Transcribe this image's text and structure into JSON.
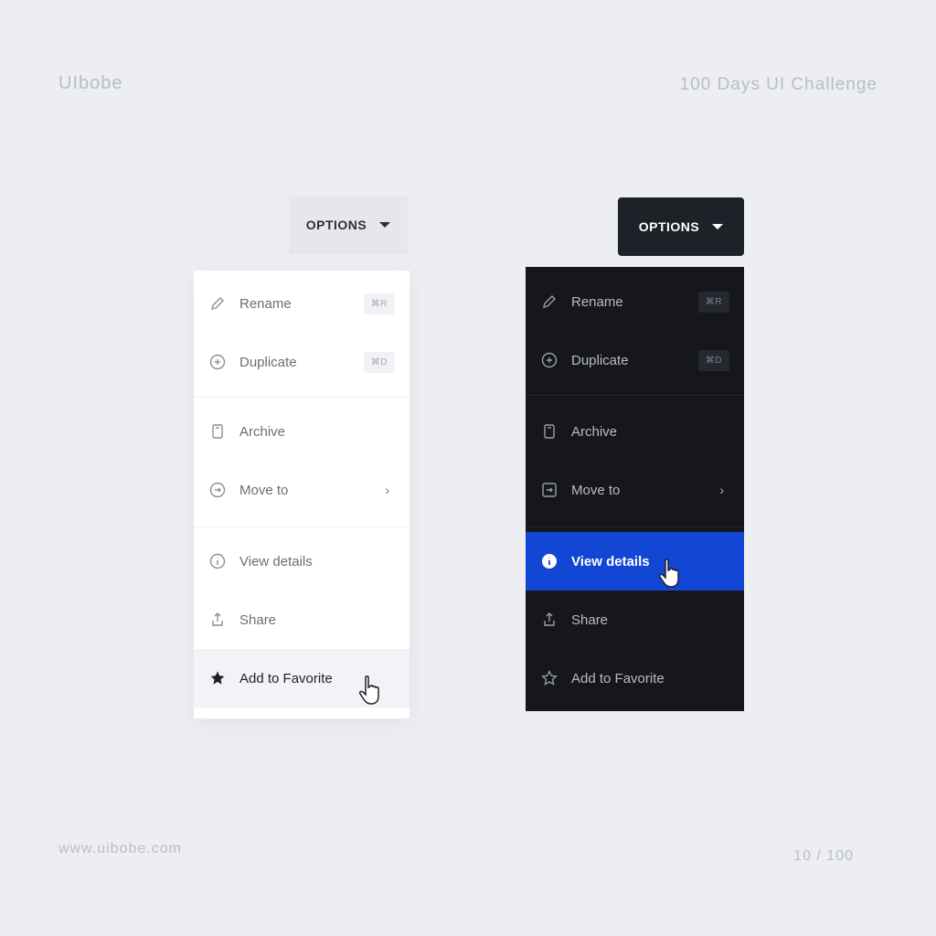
{
  "header": {
    "brand": "UIbobe",
    "series": "100 Days UI Challenge"
  },
  "footer": {
    "website": "www.uibobe.com",
    "page": "10 / 100"
  },
  "light": {
    "button_label": "OPTIONS",
    "items": [
      {
        "label": "Rename",
        "shortcut": "⌘R",
        "icon": "pencil-icon"
      },
      {
        "label": "Duplicate",
        "shortcut": "⌘D",
        "icon": "copy-circle-icon"
      },
      {
        "label": "Archive",
        "icon": "archive-icon"
      },
      {
        "label": "Move to",
        "icon": "move-circle-icon"
      },
      {
        "label": "View details",
        "icon": "info-circle-icon"
      },
      {
        "label": "Share",
        "icon": "share-icon"
      },
      {
        "label": "Add to Favorite",
        "icon": "star-icon"
      }
    ]
  },
  "dark": {
    "button_label": "OPTIONS",
    "items": [
      {
        "label": "Rename",
        "shortcut": "⌘R",
        "icon": "pencil-icon"
      },
      {
        "label": "Duplicate",
        "shortcut": "⌘D",
        "icon": "copy-circle-icon"
      },
      {
        "label": "Archive",
        "icon": "archive-icon"
      },
      {
        "label": "Move to",
        "icon": "move-icon"
      },
      {
        "label": "View details",
        "icon": "info-circle-icon"
      },
      {
        "label": "Share",
        "icon": "share-icon"
      },
      {
        "label": "Add to Favorite",
        "icon": "star-outline-icon"
      }
    ]
  },
  "colors": {
    "background": "#eceef2",
    "dark_panel": "#16171d",
    "accent": "#1446d6"
  }
}
